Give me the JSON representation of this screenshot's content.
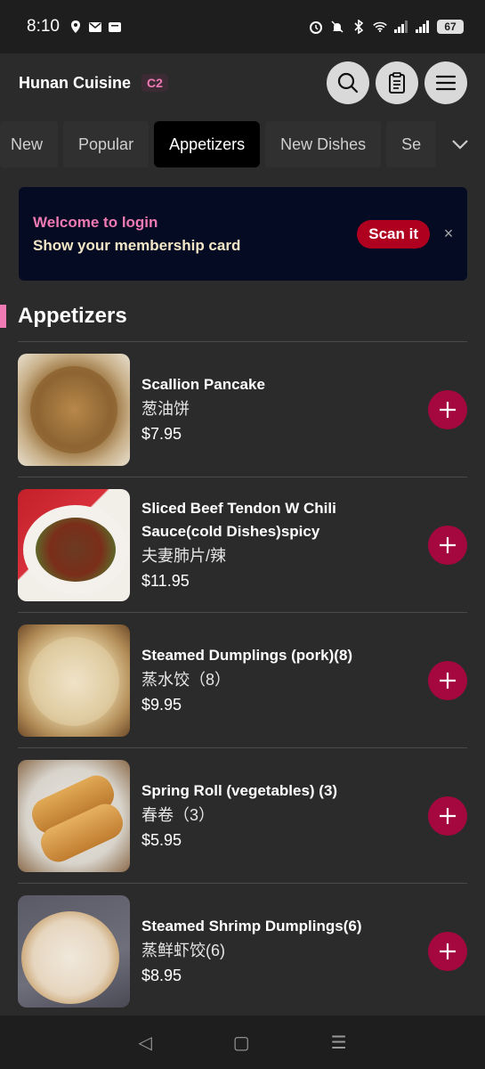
{
  "status": {
    "time": "8:10",
    "battery": "67"
  },
  "header": {
    "store_name": "Hunan Cuisine",
    "badge": "C2",
    "actions": [
      "search-icon",
      "clipboard-icon",
      "menu-icon"
    ]
  },
  "tabs": [
    {
      "label": "New",
      "active": false
    },
    {
      "label": "Popular",
      "active": false
    },
    {
      "label": "Appetizers",
      "active": true
    },
    {
      "label": "New Dishes",
      "active": false
    },
    {
      "label": "Se",
      "active": false
    }
  ],
  "banner": {
    "line1": "Welcome to login",
    "line2": "Show your membership card",
    "button": "Scan it",
    "close": "×"
  },
  "section": {
    "title": "Appetizers"
  },
  "items": [
    {
      "name": "Scallion Pancake",
      "name_zh": "葱油饼",
      "price": "$7.95"
    },
    {
      "name": "Sliced Beef Tendon W Chili Sauce(cold Dishes)spicy",
      "name_zh": "夫妻肺片/辣",
      "price": "$11.95"
    },
    {
      "name": "Steamed Dumplings (pork)(8)",
      "name_zh": "蒸水饺（8）",
      "price": "$9.95"
    },
    {
      "name": "Spring Roll (vegetables) (3)",
      "name_zh": "春卷（3）",
      "price": "$5.95"
    },
    {
      "name": "Steamed Shrimp Dumplings(6)",
      "name_zh": "蒸鲜虾饺(6)",
      "price": "$8.95"
    }
  ],
  "nav": {
    "back": "◁",
    "home": "▢",
    "recents": "☰"
  },
  "colors": {
    "accent_pink": "#f07ab4",
    "add_button": "#a5083f",
    "scan_button": "#b00020",
    "banner_bg": "#050b22"
  }
}
